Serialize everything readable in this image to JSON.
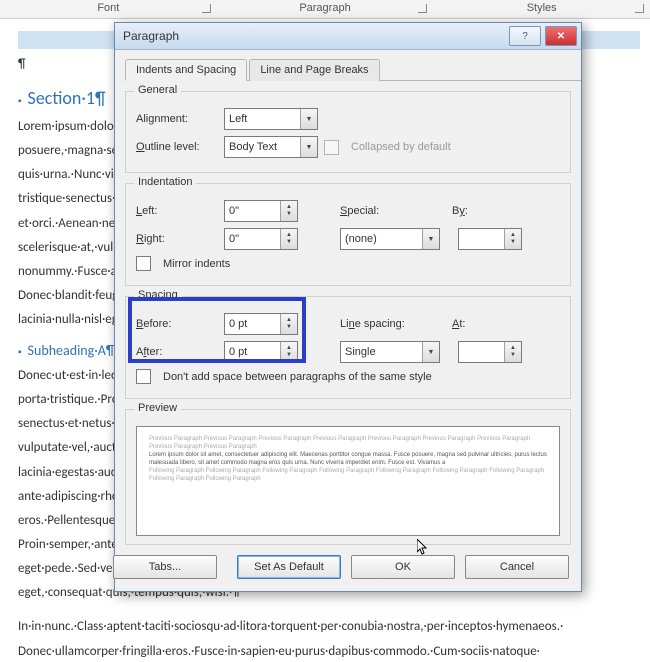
{
  "ribbon": {
    "font": "Font",
    "paragraph": "Paragraph",
    "styles": "Styles"
  },
  "doc": {
    "heading1": "Section·1¶",
    "heading2": "Subheading·A¶",
    "pilcrow": "¶",
    "p1": "Lorem·ipsum·dolor·sit·amet,·consectetuer·adipiscing·elit.·Maecenas·porttitor·congue·massa.·Fusce·",
    "p2": "posuere,·magna·sed·pulvinar·ultricies,·purus·lectus·malesuada·libero,·sit·amet·commodo·magna·eros·",
    "p3": "quis·urna.·Nunc·viverra·imperdiet·enim.·Fusce·est.·Vivamus·a·tellus.·Pellentesque·habitant·morbi·",
    "p4": "tristique·senectus·et·netus·et·malesuada·fames·ac·turpis·egestas.·Proin·pharetra·nonummy·pede.·Mauris·",
    "p5": "et·orci.·Aenean·nec·lorem.·In·porttitor.·Donec·laoreet·nonummy·augue.·Suspendisse·dui·purus,·",
    "p6": "scelerisque·at,·vulputate·vitae,·pretium·mattis,·nunc.·Mauris·eget·neque·at·sem·venenatis·eleifend.·Ut·",
    "p7": "nonummy.·Fusce·aliquet·pede·non·pede.·Suspendisse·dapibus·lorem·pellentesque·magna.·Integer·nulla.·",
    "p8": "Donec·blandit·feugiat·ligula.·Donec·hendrerit,·felis·et·imperdiet·euismod,·purus·ipsum·pretium·metus,·in·",
    "p9": "lacinia·nulla·nisl·eget·sapien.·¶",
    "q1": "Donec·ut·est·in·lectus·consequat·consequat.·Etiam·eget·dui.·Aliquam·erat·volutpat.·Sed·at·lorem·in·nunc·",
    "q2": "porta·tristique.·Proin·nec·augue.·Quisque·aliquam·tempor·magna.·Pellentesque·habitant·morbi·tristique·",
    "q3": "senectus·et·netus·et·malesuada·fames·ac·turpis·egestas.·Nunc·ac·magna.·Maecenas·odio·dolor,·",
    "q4": "vulputate·vel,·auctor·ac,·accumsan·id,·felis.·Pellentesque·cursus·sagittis·felis.·Pellentesque·porttitor,·velit·",
    "q5": "lacinia·egestas·auctor,·diam·eros·tempus·arcu,·nec·vulputate·augue·magna·vel·risus.·Cras·non·magna·vel·",
    "q6": "ante·adipiscing·rhoncus.·Vivamus·a·mi.·Morbi·neque.·Aliquam·erat·volutpat.·Integer·ultrices·lobortis·",
    "q7": "eros.·Pellentesque·habitant·morbi·tristique·senectus·et·netus·et·malesuada·fames·ac·turpis·egestas.·",
    "q8": "Proin·semper,·ante·vitae·sollicitudin·posuere,·metus·quam·iaculis·nibh,·vitae·scelerisque·nunc·massa·",
    "q9": "eget·pede.·Sed·velit·urna,·interdum·vel,·ultricies·vel,·faucibus·at,·quam.·Donec·elit·est,·consectetuer·",
    "q10": "eget,·consequat·quis,·tempus·quis,·wisi.·¶",
    "r1": "In·in·nunc.·Class·aptent·taciti·sociosqu·ad·litora·torquent·per·conubia·nostra,·per·inceptos·hymenaeos.·",
    "r2": "Donec·ullamcorper·fringilla·eros.·Fusce·in·sapien·eu·purus·dapibus·commodo.·Cum·sociis·natoque·"
  },
  "dialog": {
    "title": "Paragraph",
    "tab1": "Indents and Spacing",
    "tab2": "Line and Page Breaks",
    "general": "General",
    "alignment_label": "Alignment:",
    "alignment_value": "Left",
    "outline_label": "Outline level:",
    "outline_value": "Body Text",
    "collapsed": "Collapsed by default",
    "indentation": "Indentation",
    "left_label": "Left:",
    "left_value": "0\"",
    "right_label": "Right:",
    "right_value": "0\"",
    "special_label": "Special:",
    "special_value": "(none)",
    "by_label": "By:",
    "by_value": "",
    "mirror": "Mirror indents",
    "spacing": "Spacing",
    "before_label": "Before:",
    "before_value": "0 pt",
    "after_label": "After:",
    "after_value": "0 pt",
    "linespacing_label": "Line spacing:",
    "linespacing_value": "Single",
    "at_label": "At:",
    "at_value": "",
    "nospace": "Don't add space between paragraphs of the same style",
    "preview": "Preview",
    "preview_gray": "Previous Paragraph Previous Paragraph Previous Paragraph Previous Paragraph Previous Paragraph Previous Paragraph Previous Paragraph Previous Paragraph Previous Paragraph",
    "preview_dark": "Lorem ipsum dolor sit amet, consectetuer adipiscing elit. Maecenas porttitor congue massa. Fusce posuere, magna sed pulvinar ultricies, purus lectus malesuada libero, sit amet commodo magna eros quis urna. Nunc viverra imperdiet enim. Fusce est. Vivamus a",
    "preview_gray2": "Following Paragraph Following Paragraph Following Paragraph Following Paragraph Following Paragraph Following Paragraph Following Paragraph Following Paragraph Following Paragraph",
    "btn_tabs": "Tabs...",
    "btn_default": "Set As Default",
    "btn_ok": "OK",
    "btn_cancel": "Cancel"
  }
}
